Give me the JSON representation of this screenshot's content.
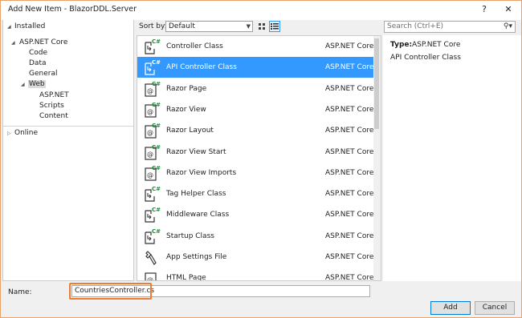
{
  "window": {
    "title": "Add New Item - BlazorDDL.Server",
    "help_button": "?",
    "close_button": "✕"
  },
  "toolbar": {
    "sort_label": "Sort by:",
    "sort_value": "Default",
    "search_placeholder": "Search (Ctrl+E)"
  },
  "tree": {
    "installed": "Installed",
    "asp_net_core": "ASP.NET Core",
    "code": "Code",
    "data": "Data",
    "general": "General",
    "web": "Web",
    "web_aspnet": "ASP.NET",
    "scripts": "Scripts",
    "content": "Content",
    "online": "Online"
  },
  "templates": [
    {
      "name": "Controller Class",
      "category": "ASP.NET Core",
      "icon": "controller-class-icon"
    },
    {
      "name": "API Controller Class",
      "category": "ASP.NET Core",
      "icon": "api-controller-class-icon"
    },
    {
      "name": "Razor Page",
      "category": "ASP.NET Core",
      "icon": "razor-page-icon"
    },
    {
      "name": "Razor View",
      "category": "ASP.NET Core",
      "icon": "razor-view-icon"
    },
    {
      "name": "Razor Layout",
      "category": "ASP.NET Core",
      "icon": "razor-layout-icon"
    },
    {
      "name": "Razor View Start",
      "category": "ASP.NET Core",
      "icon": "razor-view-start-icon"
    },
    {
      "name": "Razor View Imports",
      "category": "ASP.NET Core",
      "icon": "razor-view-imports-icon"
    },
    {
      "name": "Tag Helper Class",
      "category": "ASP.NET Core",
      "icon": "tag-helper-class-icon"
    },
    {
      "name": "Middleware Class",
      "category": "ASP.NET Core",
      "icon": "middleware-class-icon"
    },
    {
      "name": "Startup Class",
      "category": "ASP.NET Core",
      "icon": "startup-class-icon"
    },
    {
      "name": "App Settings File",
      "category": "ASP.NET Core",
      "icon": "app-settings-file-icon"
    },
    {
      "name": "HTML Page",
      "category": "ASP.NET Core",
      "icon": "html-page-icon"
    }
  ],
  "selected_template_index": 1,
  "info": {
    "type_label": "Type:",
    "type_value": "ASP.NET Core",
    "description": "API Controller Class"
  },
  "name_field": {
    "label": "Name:",
    "value": "CountriesController.cs"
  },
  "buttons": {
    "add": "Add",
    "cancel": "Cancel"
  },
  "colors": {
    "selection": "#3399ff",
    "highlight_border": "#ee7d31",
    "csharp_green": "#1e8a3c"
  }
}
